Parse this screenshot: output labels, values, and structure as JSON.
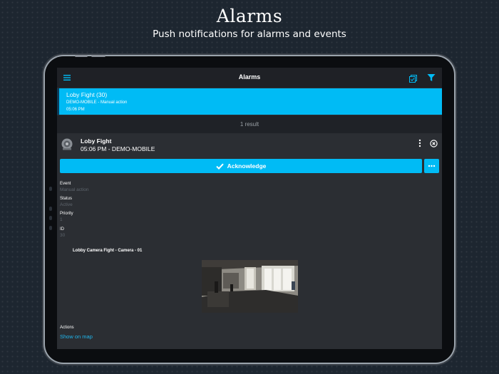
{
  "promo": {
    "title": "Alarms",
    "subtitle": "Push notifications for alarms and events"
  },
  "app": {
    "title": "Alarms",
    "icons": {
      "menu": "hamburger-menu-icon",
      "select": "multi-select-icon",
      "filter": "filter-icon"
    },
    "accent_color": "#00bbf5"
  },
  "alarm_list": {
    "items": [
      {
        "title": "Loby Fight (30)",
        "source": "DEMO-MOBILE - Manual action",
        "time": "05:06 PM"
      }
    ],
    "result_count": "1 result"
  },
  "detail": {
    "name": "Loby Fight",
    "time_source": "05:06 PM - DEMO-MOBILE",
    "acknowledge_label": "Acknowledge",
    "fields": [
      {
        "label": "Event",
        "value": "Manual action"
      },
      {
        "label": "Status",
        "value": "Active"
      },
      {
        "label": "Priority",
        "value": "1"
      },
      {
        "label": "ID",
        "value": "30"
      }
    ],
    "camera_title": "Lobby Camera Fight - Camera - 01",
    "actions_label": "Actions",
    "show_on_map": "Show on map"
  }
}
